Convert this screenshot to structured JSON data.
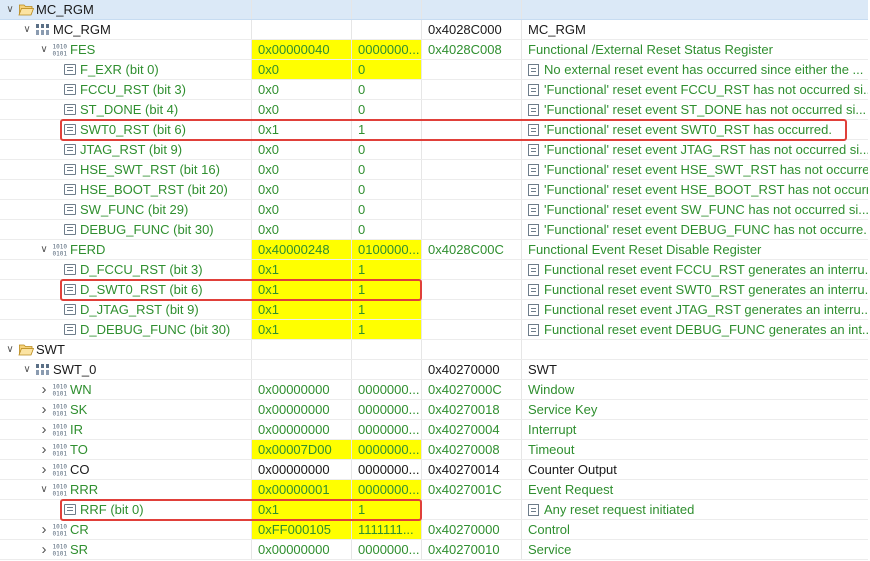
{
  "highlight_color": "#ffff00",
  "annotation_color": "#e0403a",
  "rows": [
    {
      "id": "mc_rgm_folder",
      "level": 0,
      "expanded": true,
      "icon": "folder-open-icon",
      "name": "MC_RGM",
      "value": "",
      "raw": "",
      "address": "",
      "description": "",
      "selected": true,
      "green": false,
      "hl_value": false,
      "hl_raw": false
    },
    {
      "id": "mc_rgm_periph",
      "level": 1,
      "expanded": true,
      "icon": "peripheral-icon",
      "name": "MC_RGM",
      "value": "",
      "raw": "",
      "address": "0x4028C000",
      "description": "MC_RGM",
      "green": false,
      "hl_value": false,
      "hl_raw": false
    },
    {
      "id": "fes",
      "level": 2,
      "expanded": true,
      "icon": "register-icon",
      "name": "FES",
      "value": "0x00000040",
      "raw": "0000000...",
      "address": "0x4028C008",
      "description": "Functional /External Reset Status Register",
      "green": true,
      "hl_value": true,
      "hl_raw": true
    },
    {
      "id": "f_exr",
      "level": 3,
      "icon": "field-icon",
      "name": "F_EXR (bit 0)",
      "value": "0x0",
      "raw": "0",
      "address": "",
      "description": "No external reset event has occurred since either the ...",
      "green": true,
      "hl_value": true,
      "hl_raw": true,
      "desc_icon": true
    },
    {
      "id": "fccu_rst",
      "level": 3,
      "icon": "field-icon",
      "name": "FCCU_RST (bit 3)",
      "value": "0x0",
      "raw": "0",
      "address": "",
      "description": "'Functional' reset event FCCU_RST has not occurred si...",
      "green": true,
      "desc_icon": true
    },
    {
      "id": "st_done",
      "level": 3,
      "icon": "field-icon",
      "name": "ST_DONE (bit 4)",
      "value": "0x0",
      "raw": "0",
      "address": "",
      "description": "'Functional' reset event ST_DONE has not occurred si...",
      "green": true,
      "desc_icon": true
    },
    {
      "id": "swt0_rst",
      "level": 3,
      "icon": "field-icon",
      "name": "SWT0_RST (bit 6)",
      "value": "0x1",
      "raw": "1",
      "address": "",
      "description": "'Functional' reset event SWT0_RST has occurred.",
      "green": true,
      "desc_icon": true
    },
    {
      "id": "jtag_rst",
      "level": 3,
      "icon": "field-icon",
      "name": "JTAG_RST (bit 9)",
      "value": "0x0",
      "raw": "0",
      "address": "",
      "description": "'Functional' reset event JTAG_RST has not occurred si...",
      "green": true,
      "desc_icon": true
    },
    {
      "id": "hse_swt_rst",
      "level": 3,
      "icon": "field-icon",
      "name": "HSE_SWT_RST (bit 16)",
      "value": "0x0",
      "raw": "0",
      "address": "",
      "description": "'Functional' reset event HSE_SWT_RST has not occurre...",
      "green": true,
      "desc_icon": true
    },
    {
      "id": "hse_boot_rst",
      "level": 3,
      "icon": "field-icon",
      "name": "HSE_BOOT_RST (bit 20)",
      "value": "0x0",
      "raw": "0",
      "address": "",
      "description": "'Functional' reset event HSE_BOOT_RST has not occurr...",
      "green": true,
      "desc_icon": true
    },
    {
      "id": "sw_func",
      "level": 3,
      "icon": "field-icon",
      "name": "SW_FUNC (bit 29)",
      "value": "0x0",
      "raw": "0",
      "address": "",
      "description": "'Functional' reset event SW_FUNC has not occurred si...",
      "green": true,
      "desc_icon": true
    },
    {
      "id": "debug_func",
      "level": 3,
      "icon": "field-icon",
      "name": "DEBUG_FUNC (bit 30)",
      "value": "0x0",
      "raw": "0",
      "address": "",
      "description": "'Functional' reset event DEBUG_FUNC has not occurre...",
      "green": true,
      "desc_icon": true
    },
    {
      "id": "ferd",
      "level": 2,
      "expanded": true,
      "icon": "register-icon",
      "name": "FERD",
      "value": "0x40000248",
      "raw": "0100000...",
      "address": "0x4028C00C",
      "description": "Functional Event Reset Disable Register",
      "green": true,
      "hl_value": true,
      "hl_raw": true
    },
    {
      "id": "d_fccu_rst",
      "level": 3,
      "icon": "field-icon",
      "name": "D_FCCU_RST (bit 3)",
      "value": "0x1",
      "raw": "1",
      "address": "",
      "description": "Functional reset event FCCU_RST generates an interru...",
      "green": true,
      "hl_value": true,
      "hl_raw": true,
      "desc_icon": true
    },
    {
      "id": "d_swt0_rst",
      "level": 3,
      "icon": "field-icon",
      "name": "D_SWT0_RST (bit 6)",
      "value": "0x1",
      "raw": "1",
      "address": "",
      "description": "Functional reset event SWT0_RST generates an interru...",
      "green": true,
      "hl_value": true,
      "hl_raw": true,
      "desc_icon": true
    },
    {
      "id": "d_jtag_rst",
      "level": 3,
      "icon": "field-icon",
      "name": "D_JTAG_RST (bit 9)",
      "value": "0x1",
      "raw": "1",
      "address": "",
      "description": "Functional reset event JTAG_RST generates an interru...",
      "green": true,
      "hl_value": true,
      "hl_raw": true,
      "desc_icon": true
    },
    {
      "id": "d_debug_func",
      "level": 3,
      "icon": "field-icon",
      "name": "D_DEBUG_FUNC (bit 30)",
      "value": "0x1",
      "raw": "1",
      "address": "",
      "description": "Functional reset event DEBUG_FUNC generates an int...",
      "green": true,
      "hl_value": true,
      "hl_raw": true,
      "desc_icon": true
    },
    {
      "id": "swt_folder",
      "level": 0,
      "expanded": true,
      "icon": "folder-open-icon",
      "name": "SWT",
      "value": "",
      "raw": "",
      "address": "",
      "description": "",
      "green": false
    },
    {
      "id": "swt_0",
      "level": 1,
      "expanded": true,
      "icon": "peripheral-icon",
      "name": "SWT_0",
      "value": "",
      "raw": "",
      "address": "0x40270000",
      "description": "SWT",
      "green": false
    },
    {
      "id": "wn",
      "level": 2,
      "expanded": false,
      "icon": "register-icon",
      "name": "WN",
      "value": "0x00000000",
      "raw": "0000000...",
      "address": "0x4027000C",
      "description": "Window",
      "green": true
    },
    {
      "id": "sk",
      "level": 2,
      "expanded": false,
      "icon": "register-icon",
      "name": "SK",
      "value": "0x00000000",
      "raw": "0000000...",
      "address": "0x40270018",
      "description": "Service Key",
      "green": true
    },
    {
      "id": "ir",
      "level": 2,
      "expanded": false,
      "icon": "register-icon",
      "name": "IR",
      "value": "0x00000000",
      "raw": "0000000...",
      "address": "0x40270004",
      "description": "Interrupt",
      "green": true
    },
    {
      "id": "to",
      "level": 2,
      "expanded": false,
      "icon": "register-icon",
      "name": "TO",
      "value": "0x00007D00",
      "raw": "0000000...",
      "address": "0x40270008",
      "description": "Timeout",
      "green": true,
      "hl_value": true,
      "hl_raw": true
    },
    {
      "id": "co",
      "level": 2,
      "expanded": false,
      "icon": "register-icon",
      "name": "CO",
      "value": "0x00000000",
      "raw": "0000000...",
      "address": "0x40270014",
      "description": "Counter Output",
      "green": false
    },
    {
      "id": "rrr",
      "level": 2,
      "expanded": true,
      "icon": "register-icon",
      "name": "RRR",
      "value": "0x00000001",
      "raw": "0000000...",
      "address": "0x4027001C",
      "description": "Event Request",
      "green": true,
      "hl_value": true,
      "hl_raw": true
    },
    {
      "id": "rrf",
      "level": 3,
      "icon": "field-icon",
      "name": "RRF (bit 0)",
      "value": "0x1",
      "raw": "1",
      "address": "",
      "description": "Any reset request initiated",
      "green": true,
      "hl_value": true,
      "hl_raw": true,
      "desc_icon": true
    },
    {
      "id": "cr",
      "level": 2,
      "expanded": false,
      "icon": "register-icon",
      "name": "CR",
      "value": "0xFF000105",
      "raw": "1111111...",
      "address": "0x40270000",
      "description": "Control",
      "green": true,
      "hl_value": true,
      "hl_raw": true
    },
    {
      "id": "sr",
      "level": 2,
      "expanded": false,
      "icon": "register-icon",
      "name": "SR",
      "value": "0x00000000",
      "raw": "0000000...",
      "address": "0x40270010",
      "description": "Service",
      "green": true
    }
  ]
}
